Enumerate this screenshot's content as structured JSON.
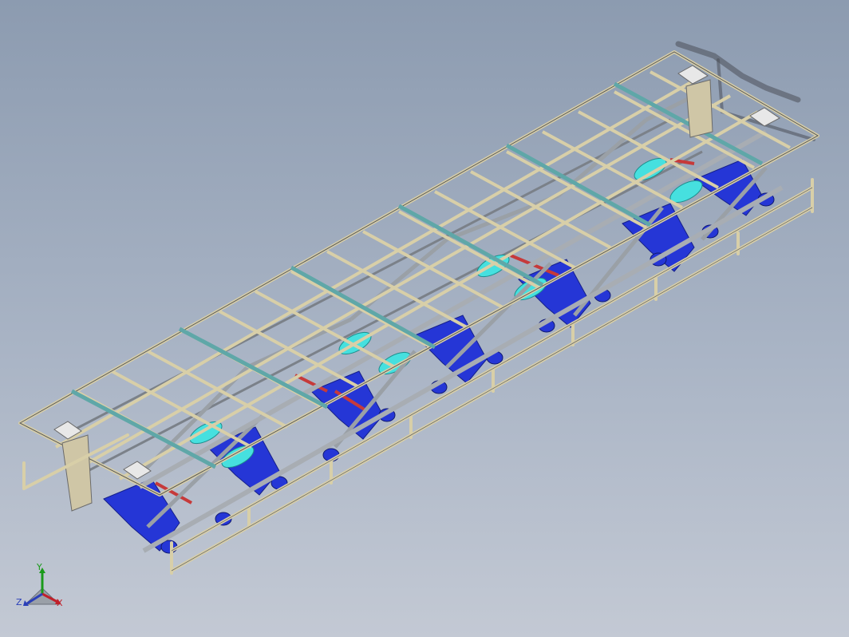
{
  "viewport": {
    "background_top": "#8c9bb0",
    "background_bottom": "#c3c9d4"
  },
  "model": {
    "frame_color": "#d8cfa8",
    "frame_outline": "#5a5a5a",
    "truss_color": "#9aa0a6",
    "idler_color": "#2536d6",
    "roller_color": "#46e0df",
    "pipe_color": "#c63a3a",
    "beam_color": "#5fa7a8",
    "plate_color": "#e8e8e8"
  },
  "triad": {
    "y_label": "Y",
    "z_label": "Z",
    "x_label": "X",
    "y_color": "#1a9a1a",
    "z_color": "#2a3fb8",
    "x_color": "#c0202a"
  }
}
